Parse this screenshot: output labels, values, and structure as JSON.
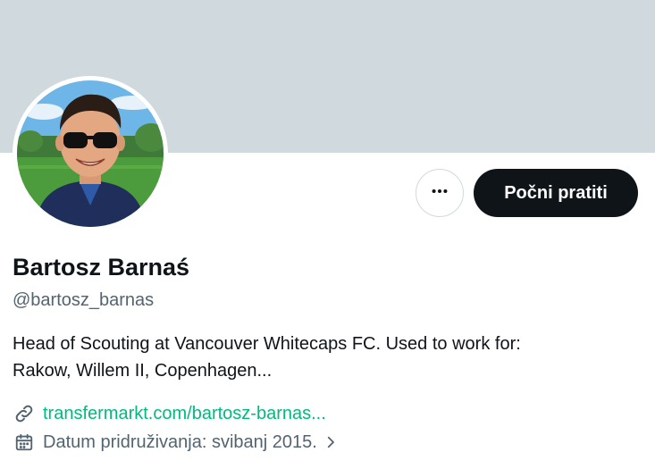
{
  "profile": {
    "display_name": "Bartosz Barnaś",
    "handle": "@bartosz_barnas",
    "bio_line1": "Head of Scouting at Vancouver Whitecaps FC. Used to work for:",
    "bio_line2": "Rakow, Willem II, Copenhagen...",
    "website": "transfermarkt.com/bartosz-barnas...",
    "joined": "Datum pridruživanja: svibanj 2015."
  },
  "actions": {
    "follow_label": "Počni pratiti",
    "more_icon": "more-horizontal-icon"
  },
  "icons": {
    "link": "link-icon",
    "calendar": "calendar-icon",
    "chevron": "chevron-right-icon"
  },
  "colors": {
    "banner": "#cfd9de",
    "follow_bg": "#0f1419",
    "link": "#00ba7c",
    "secondary_text": "#536471"
  }
}
